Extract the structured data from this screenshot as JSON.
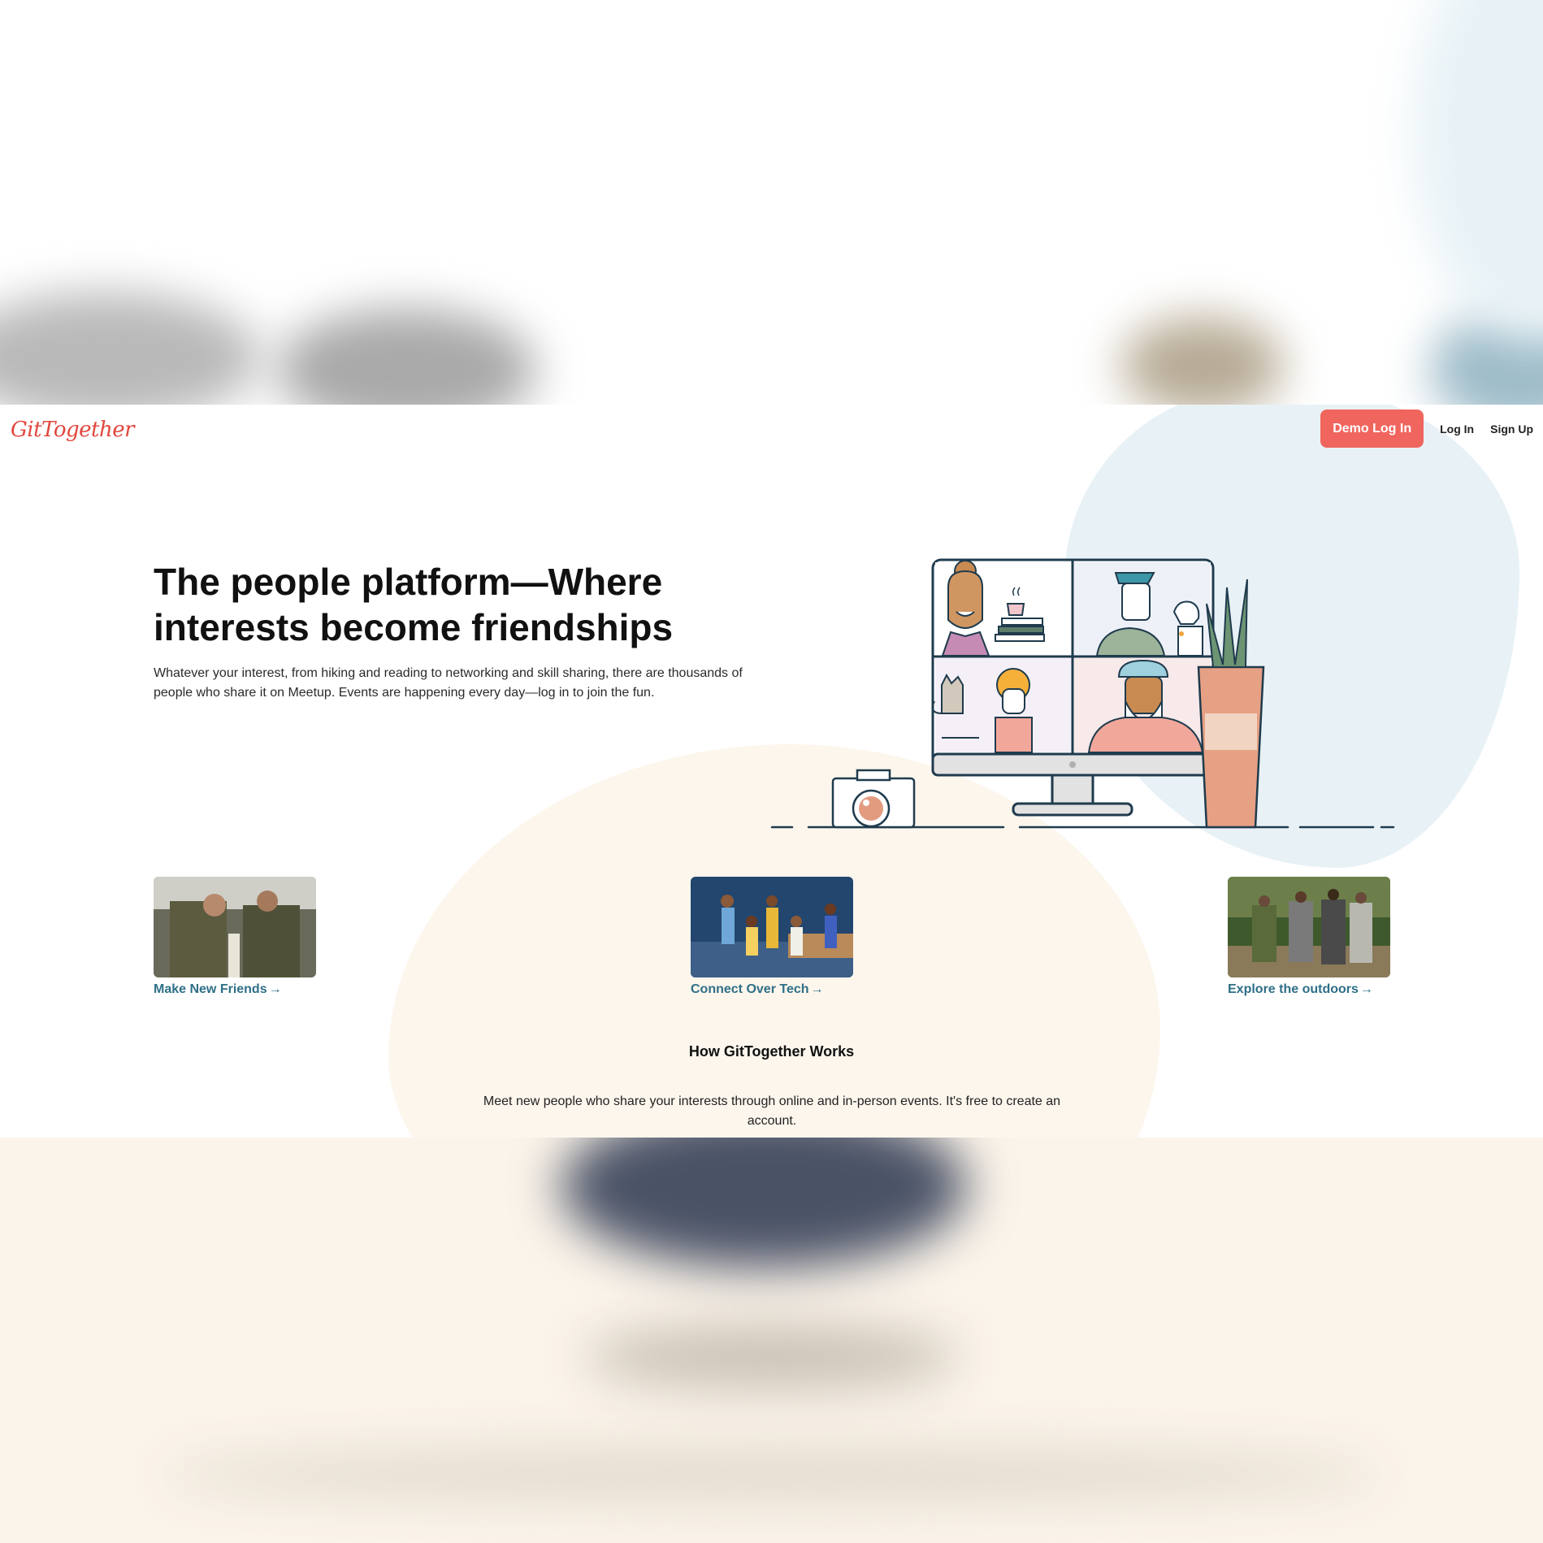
{
  "brand": {
    "logo_text": "GitTogether",
    "logo_color": "#e2463d"
  },
  "nav": {
    "demo_login": "Demo Log In",
    "login": "Log In",
    "signup": "Sign Up"
  },
  "hero": {
    "title": "The people platform—Where interests become friendships",
    "subtitle": "Whatever your interest, from hiking and reading to networking and skill sharing, there are thousands of people who share it on Meetup. Events are happening every day—log in to join the fun."
  },
  "cards": [
    {
      "label": "Make New Friends",
      "arrow": "→"
    },
    {
      "label": "Connect Over Tech",
      "arrow": "→"
    },
    {
      "label": "Explore the outdoors",
      "arrow": "→"
    }
  ],
  "how": {
    "title": "How GitTogether Works",
    "text": "Meet new people who share your interests through online and in-person events. It's free to create an account."
  },
  "colors": {
    "accent": "#f0655e",
    "link": "#2f6f86",
    "blue_blob": "#e8f2f6",
    "cream_blob": "#fcf6ed"
  }
}
